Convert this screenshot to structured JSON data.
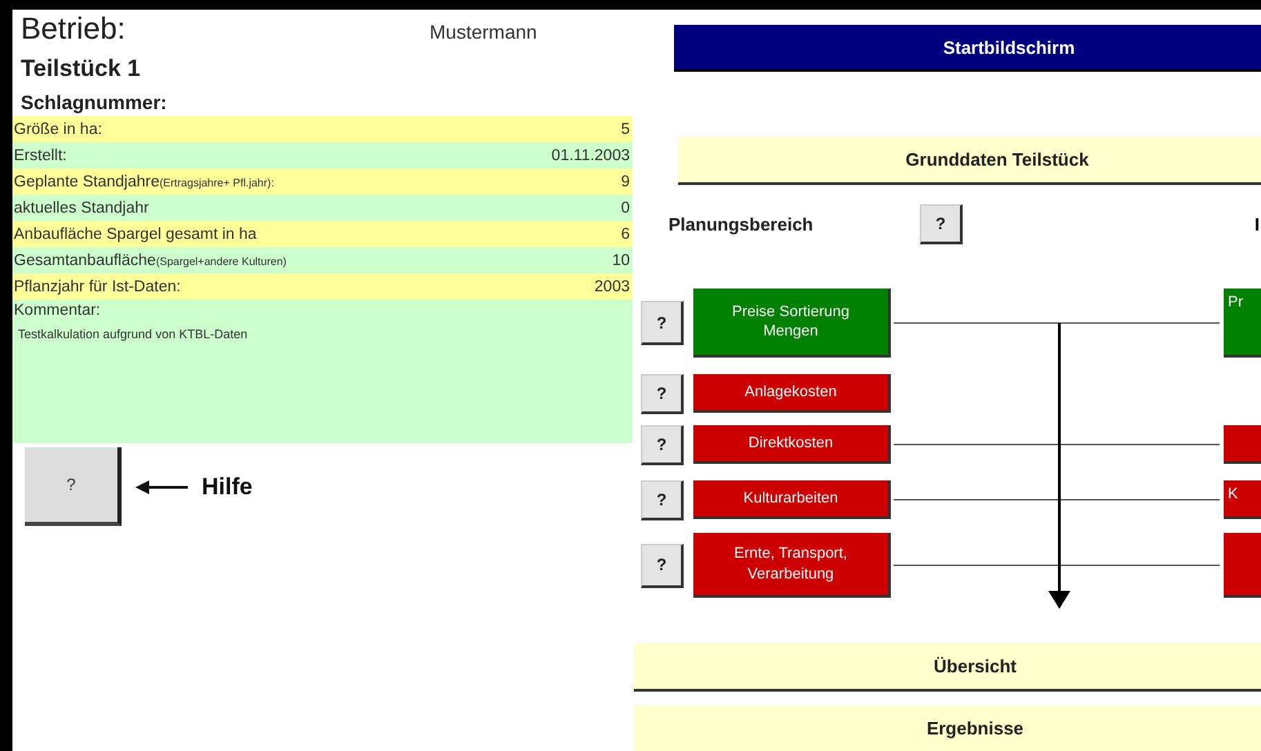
{
  "header": {
    "label": "Betrieb:",
    "name": "Mustermann",
    "plot": "Teilstück 1",
    "field_number_label": "Schlagnummer:"
  },
  "fields": [
    {
      "label": "Größe in ha:",
      "value": "5",
      "color": "#ffff99"
    },
    {
      "label": "Erstellt:",
      "value": "01.11.2003",
      "color": "#ccffcc"
    },
    {
      "label": "Geplante Standjahre",
      "note": "(Ertragsjahre+ Pfl.jahr):",
      "value": "9",
      "color": "#ffff99"
    },
    {
      "label": "aktuelles Standjahr",
      "value": "0",
      "color": "#ccffcc"
    },
    {
      "label": "Anbaufläche Spargel gesamt in ha",
      "value": "6",
      "color": "#ffff99"
    },
    {
      "label": "Gesamtanbaufläche",
      "note": "(Spargel+andere Kulturen)",
      "value": "10",
      "color": "#ccffcc"
    },
    {
      "label": "Pflanzjahr für Ist-Daten:",
      "value": "2003",
      "color": "#ffff99"
    }
  ],
  "comment": {
    "label": "Kommentar:",
    "text": "Testkalkulation aufgrund von KTBL-Daten"
  },
  "help": {
    "button": "?",
    "label": "Hilfe"
  },
  "start_button": "Startbildschirm",
  "basics_button": "Grunddaten Teilstück",
  "planning": {
    "label": "Planungsbereich",
    "help": "?",
    "actual_label": "I"
  },
  "diagram": [
    {
      "help": "?",
      "label": "Preise Sortierung Mengen",
      "color": "#008000",
      "right": {
        "label": "Pr",
        "color": "#008000"
      }
    },
    {
      "help": "?",
      "label": "Anlagekosten",
      "color": "#cc0000"
    },
    {
      "help": "?",
      "label": "Direktkosten",
      "color": "#cc0000",
      "right": {
        "color": "#cc0000"
      }
    },
    {
      "help": "?",
      "label": "Kulturarbeiten",
      "color": "#cc0000",
      "right": {
        "label": "K",
        "color": "#cc0000"
      }
    },
    {
      "help": "?",
      "label": "Ernte, Transport, Verarbeitung",
      "color": "#cc0000",
      "right": {
        "color": "#cc0000"
      }
    }
  ],
  "bottom_buttons": [
    "Übersicht",
    "Ergebnisse"
  ]
}
